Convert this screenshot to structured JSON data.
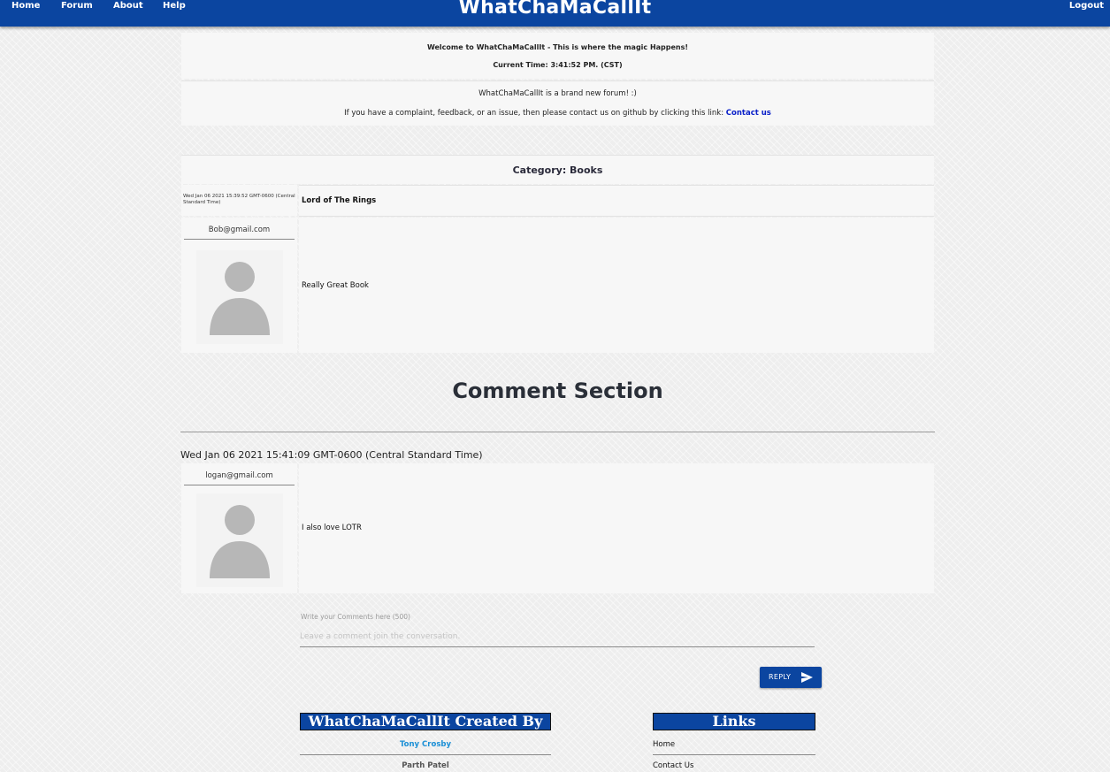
{
  "nav": {
    "home": "Home",
    "forum": "Forum",
    "about": "About",
    "help": "Help",
    "brand": "WhatChaMaCallIt",
    "logout": "Logout"
  },
  "welcome": {
    "line1": "Welcome to WhatChaMaCallIt - This is where the magic Happens!",
    "line2": "Current Time: 3:41:52 PM. (CST)"
  },
  "info": {
    "line1": "WhatChaMaCallIt is a brand new forum! :)",
    "line2": "If you have a complaint, feedback, or an issue, then please contact us on github by clicking this link:",
    "contact_link": "Contact us"
  },
  "category": "Category: Books",
  "post": {
    "timestamp": "Wed Jan 06 2021 15:39:52 GMT-0600 (Central Standard Time)",
    "title": "Lord of The Rings",
    "author": "Bob@gmail.com",
    "body": "Really Great Book"
  },
  "comments_section": {
    "title": "Comment Section",
    "comments": [
      {
        "timestamp": "Wed Jan 06 2021 15:41:09 GMT-0600 (Central Standard Time)",
        "author": "logan@gmail.com",
        "body": "I also love LOTR"
      }
    ]
  },
  "comment_form": {
    "label": "Write your Comments here (500)",
    "placeholder": "Leave a comment join the conversation.",
    "value": "",
    "reply_label": "REPLY"
  },
  "footer": {
    "created_by_title": "WhatChaMaCallIt Created By",
    "authors": [
      "Tony Crosby",
      "Parth Patel"
    ],
    "links_title": "Links",
    "links": [
      "Home",
      "Contact Us"
    ]
  },
  "colors": {
    "nav_bg": "#0b45a0",
    "link_blue": "#0a20c8",
    "author_link": "#1a8fd6"
  }
}
